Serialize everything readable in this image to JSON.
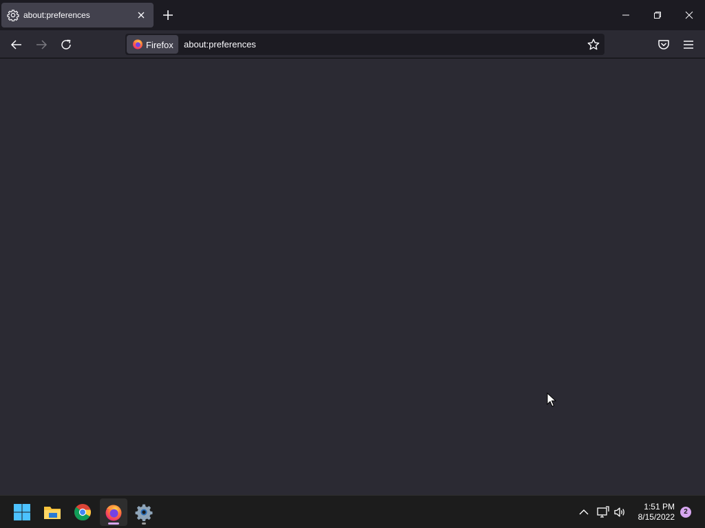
{
  "browser": {
    "name": "Firefox",
    "tab": {
      "title": "about:preferences",
      "icon": "gear-icon"
    },
    "urlbar": {
      "identity_label": "Firefox",
      "url": "about:preferences"
    },
    "toolbar_icons": [
      "back-arrow-icon",
      "forward-arrow-icon",
      "reload-icon",
      "star-icon",
      "pocket-icon",
      "hamburger-menu-icon"
    ],
    "window_controls": [
      "minimize-icon",
      "restore-icon",
      "close-icon"
    ]
  },
  "colors": {
    "tab_strip": "#1c1b22",
    "toolbar": "#2b2a33",
    "content_background": "#2b2a33",
    "selected_tab": "#42414d",
    "urlbar": "#1c1b22",
    "accent": "#d7a6f0"
  },
  "taskbar": {
    "apps": [
      {
        "name": "Start",
        "icon": "windows-start-icon",
        "state": "idle"
      },
      {
        "name": "File Explorer",
        "icon": "folder-icon",
        "state": "idle"
      },
      {
        "name": "Google Chrome",
        "icon": "chrome-icon",
        "state": "idle"
      },
      {
        "name": "Firefox",
        "icon": "firefox-icon",
        "state": "active"
      },
      {
        "name": "Settings",
        "icon": "settings-gear-icon",
        "state": "running"
      }
    ],
    "tray_icons": [
      "chevron-up-icon",
      "network-icon",
      "volume-icon"
    ],
    "clock": {
      "time": "1:51 PM",
      "date": "8/15/2022"
    },
    "notification_count": "2"
  }
}
